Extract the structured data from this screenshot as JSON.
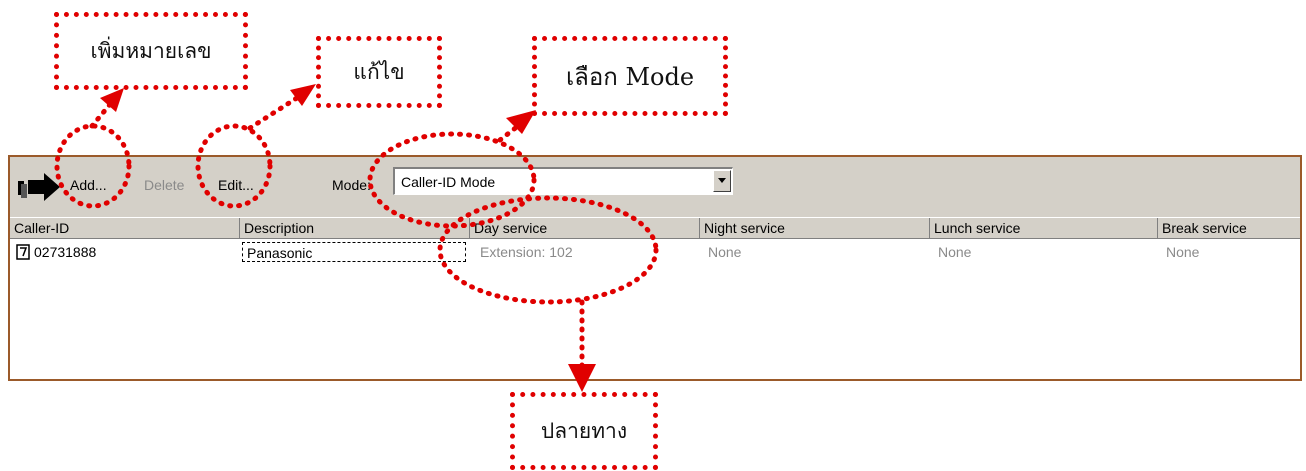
{
  "annotations": {
    "add_number": "เพิ่มหมายเลข",
    "edit": "แก้ไข",
    "select_mode": "เลือก Mode",
    "destination": "ปลายทาง"
  },
  "toolbar": {
    "add_label": "Add...",
    "delete_label": "Delete",
    "edit_label": "Edit...",
    "mode_label": "Mode:",
    "mode_value": "Caller-ID Mode"
  },
  "table": {
    "columns": [
      "Caller-ID",
      "Description",
      "Day service",
      "Night service",
      "Lunch service",
      "Break service"
    ],
    "rows": [
      {
        "caller_id": "02731888",
        "description": "Panasonic",
        "day_service": "Extension: 102",
        "night_service": "None",
        "lunch_service": "None",
        "break_service": "None"
      }
    ]
  },
  "colors": {
    "annotation": "#e00000",
    "window_border": "#9b5a2a",
    "toolbar_bg": "#d4d0c8",
    "disabled_text": "#8a8a8a"
  },
  "icons": [
    "arrow-right-icon",
    "phone-book-icon",
    "dropdown-arrow-icon"
  ]
}
